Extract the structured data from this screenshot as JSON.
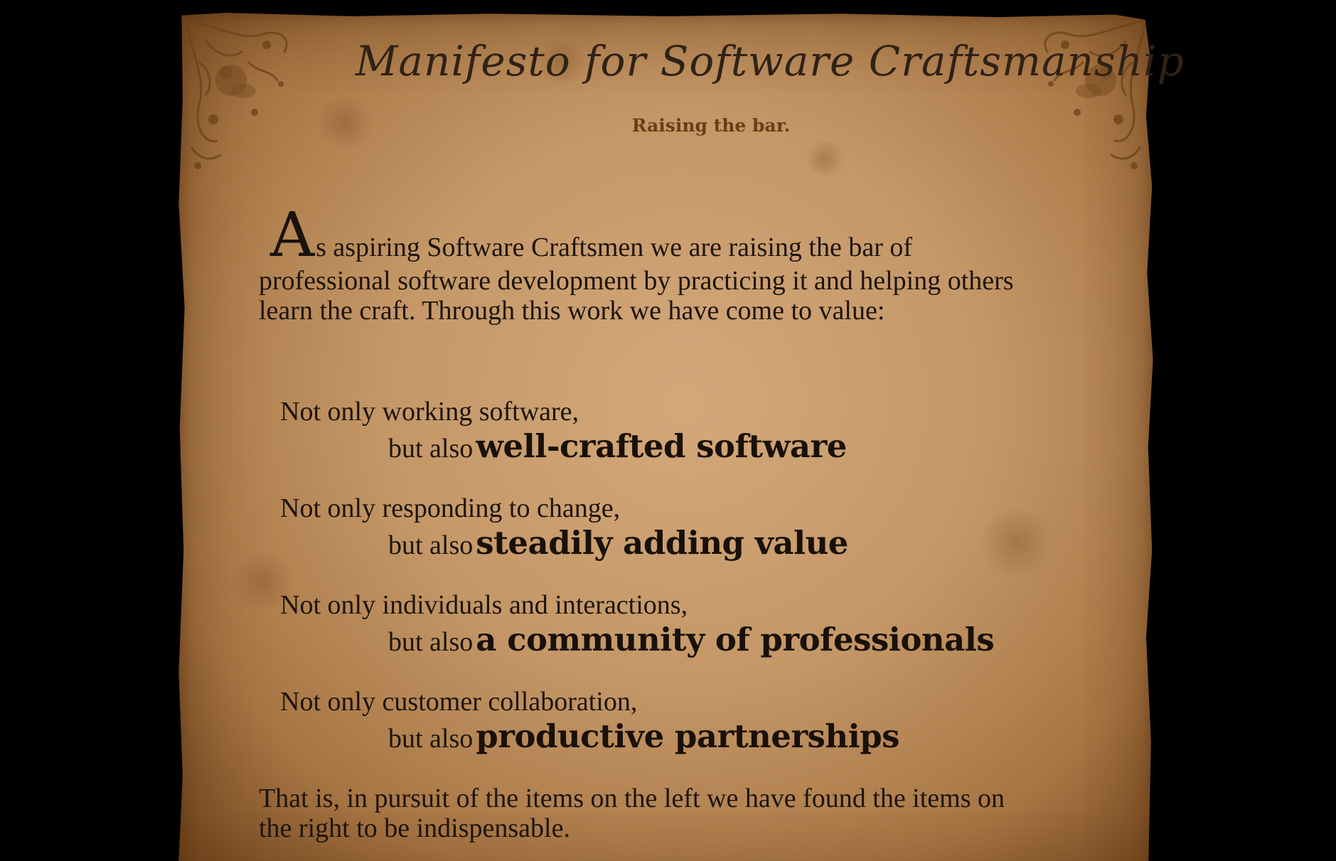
{
  "manifesto": {
    "title": "Manifesto for Software Craftsmanship",
    "subtitle": "Raising the bar.",
    "intro_dropcap": "A",
    "intro_text": "s aspiring Software Craftsmen we are raising the bar of professional software development by practicing it and helping others learn the craft. Through this work we have come to value:",
    "values": [
      {
        "not_only": "Not only working software,",
        "but_also_prefix": "but also",
        "emphasis": "well-crafted software"
      },
      {
        "not_only": "Not only responding to change,",
        "but_also_prefix": "but also",
        "emphasis": "steadily adding value"
      },
      {
        "not_only": "Not only individuals and interactions,",
        "but_also_prefix": "but also",
        "emphasis": "a community of professionals"
      },
      {
        "not_only": "Not only customer collaboration,",
        "but_also_prefix": "but also",
        "emphasis": "productive partnerships"
      }
    ],
    "closing": "That is, in pursuit of the items on the left we have found the items on the right to be indispensable."
  },
  "icons": {
    "corner_left": "floral-cherub-ornament-icon",
    "corner_right": "floral-cherub-ornament-icon"
  },
  "colors": {
    "background": "#000000",
    "parchment": "#c09060",
    "text": "#1c140e",
    "subtitle": "#6a3d17"
  }
}
